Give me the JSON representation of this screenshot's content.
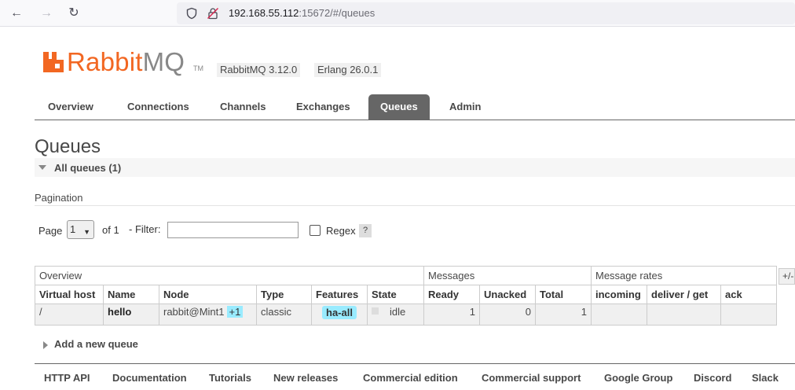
{
  "browser": {
    "url_host": "192.168.55.112",
    "url_rest": ":15672/#/queues"
  },
  "logo": {
    "brand": "Rabbit",
    "brand2": "MQ",
    "tm": "TM"
  },
  "versions": {
    "rabbitmq": "RabbitMQ 3.12.0",
    "erlang": "Erlang 26.0.1"
  },
  "tabs": [
    "Overview",
    "Connections",
    "Channels",
    "Exchanges",
    "Queues",
    "Admin"
  ],
  "page_title": "Queues",
  "section_title": "All queues (1)",
  "pagination": {
    "label": "Pagination",
    "page_label": "Page",
    "page_value": "1",
    "of_label": "of 1",
    "filter_label": "- Filter:",
    "filter_value": "",
    "regex_label": "Regex",
    "help": "?"
  },
  "table": {
    "groups": {
      "overview": "Overview",
      "messages": "Messages",
      "rates": "Message rates",
      "toggle": "+/-"
    },
    "columns": [
      "Virtual host",
      "Name",
      "Node",
      "Type",
      "Features",
      "State",
      "Ready",
      "Unacked",
      "Total",
      "incoming",
      "deliver / get",
      "ack"
    ],
    "rows": [
      {
        "vhost": "/",
        "name": "hello",
        "node": "rabbit@Mint1",
        "node_extra": "+1",
        "type": "classic",
        "features": "ha-all",
        "state": "idle",
        "ready": "1",
        "unacked": "0",
        "total": "1",
        "incoming": "",
        "deliver": "",
        "ack": ""
      }
    ]
  },
  "add_queue": "Add a new queue",
  "footer": [
    "HTTP API",
    "Documentation",
    "Tutorials",
    "New releases",
    "Commercial edition",
    "Commercial support",
    "Google Group",
    "Discord",
    "Slack"
  ]
}
